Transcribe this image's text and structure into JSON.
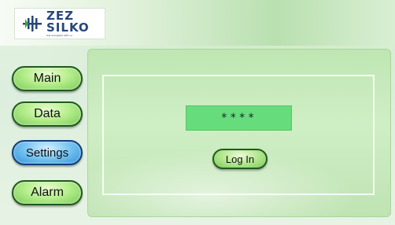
{
  "brand": {
    "line1": "ZEZ",
    "line2": "SILKO",
    "tagline": "Get energized with us"
  },
  "sidebar": {
    "items": [
      {
        "label": "Main",
        "active": false
      },
      {
        "label": "Data",
        "active": false
      },
      {
        "label": "Settings",
        "active": true
      },
      {
        "label": "Alarm",
        "active": false
      }
    ]
  },
  "login": {
    "password_value": "****",
    "button_label": "Log In"
  },
  "colors": {
    "button_green": "#b7ef8e",
    "button_active_blue": "#2b8fd8",
    "password_field": "#67dc7c",
    "logo_blue": "#27467a"
  }
}
